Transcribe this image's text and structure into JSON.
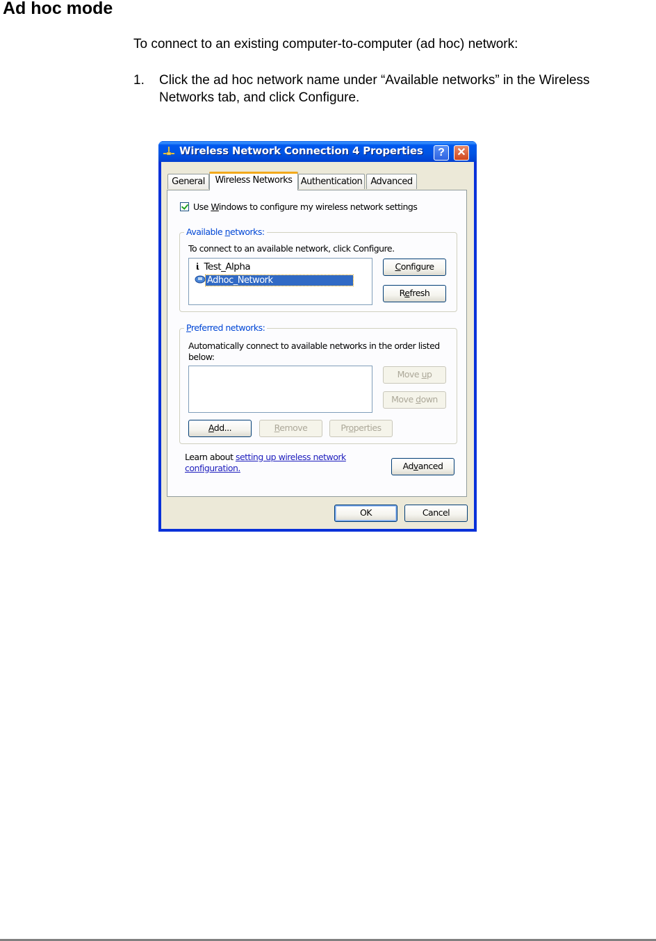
{
  "document": {
    "heading": "Ad hoc mode",
    "intro": "To connect to an existing computer-to-computer (ad hoc) network:",
    "steps": [
      {
        "number": "1.",
        "text": "Click the ad hoc network name under “Available networks” in the Wireless Networks tab, and click Configure."
      }
    ]
  },
  "dialog": {
    "title": "Wireless Network Connection 4 Properties",
    "title_icon": "network-connection-icon",
    "help_label": "?",
    "close_label": "✕",
    "tabs": [
      {
        "label": "General",
        "active": false
      },
      {
        "label": "Wireless Networks",
        "active": true
      },
      {
        "label": "Authentication",
        "active": false
      },
      {
        "label": "Advanced",
        "active": false
      }
    ],
    "use_windows_checkbox": {
      "pre": "Use ",
      "accel": "W",
      "post": "indows to configure my wireless network settings",
      "checked": true
    },
    "available": {
      "legend_pre": "Available ",
      "legend_accel": "n",
      "legend_post": "etworks:",
      "instruction": "To connect to an available network, click Configure.",
      "networks": [
        {
          "name": "Test_Alpha",
          "icon": "access-point-icon",
          "selected": false
        },
        {
          "name": "Adhoc_Network",
          "icon": "adhoc-computer-icon",
          "selected": true
        }
      ],
      "configure_accel": "C",
      "configure_rest": "onfigure",
      "refresh_pre": "R",
      "refresh_accel": "e",
      "refresh_rest": "fresh"
    },
    "preferred": {
      "legend_accel": "P",
      "legend_rest": "referred networks:",
      "instruction_line1": "Automatically connect to available networks in the order listed",
      "instruction_line2": "below:",
      "networks": [],
      "move_up_pre": "Move ",
      "move_up_accel": "u",
      "move_up_post": "p",
      "move_down_pre": "Move ",
      "move_down_accel": "d",
      "move_down_post": "own",
      "add_accel": "A",
      "add_rest": "dd...",
      "remove_accel": "R",
      "remove_rest": "emove",
      "properties_pre": "Pr",
      "properties_accel": "o",
      "properties_post": "perties"
    },
    "learn": {
      "prefix": "Learn about ",
      "link_line1": "setting up wireless network",
      "link_line2": "configuration."
    },
    "advanced_pre": "Ad",
    "advanced_accel": "v",
    "advanced_post": "anced",
    "ok_label": "OK",
    "cancel_label": "Cancel"
  }
}
